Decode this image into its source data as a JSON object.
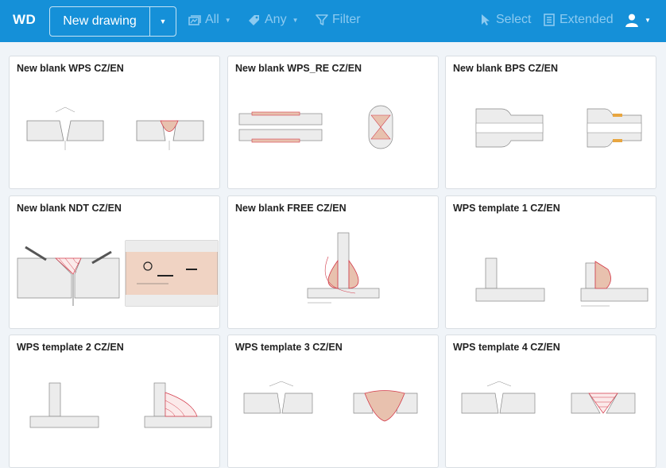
{
  "header": {
    "logo": "WD",
    "new_drawing_label": "New drawing",
    "all_label": "All",
    "any_label": "Any",
    "filter_label": "Filter",
    "select_label": "Select",
    "extended_label": "Extended"
  },
  "colors": {
    "topbar": "#1590d8",
    "muted_toolbar": "#8ccaf0",
    "weld_fill": "#e8c1ae",
    "weld_line": "#d33a4a"
  },
  "cards": [
    {
      "title": "New blank WPS CZ/EN"
    },
    {
      "title": "New blank WPS_RE CZ/EN"
    },
    {
      "title": "New blank BPS CZ/EN"
    },
    {
      "title": "New blank NDT CZ/EN"
    },
    {
      "title": "New blank FREE CZ/EN"
    },
    {
      "title": "WPS template 1 CZ/EN"
    },
    {
      "title": "WPS template 2 CZ/EN"
    },
    {
      "title": "WPS template 3 CZ/EN"
    },
    {
      "title": "WPS template 4 CZ/EN"
    }
  ]
}
